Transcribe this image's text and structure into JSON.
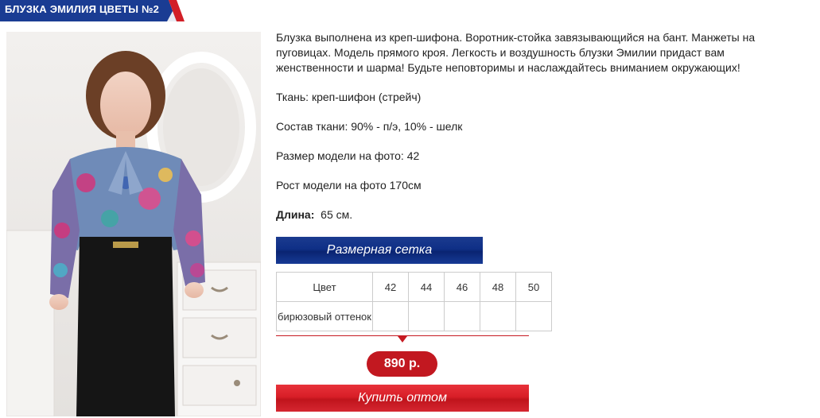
{
  "header": {
    "title": "БЛУЗКА ЭМИЛИЯ ЦВЕТЫ №2",
    "bg_color": "#1a3c93",
    "accent_color": "#d21f27"
  },
  "product": {
    "description": "Блузка выполнена из креп-шифона. Воротник-стойка завязывающийся на бант. Манжеты на пуговицах. Модель прямого кроя. Легкость и воздушность блузки Эмилии придаст вам женственности и шарма! Будьте неповторимы и наслаждайтесь вниманием окружающих!",
    "fabric": "Ткань: креп-шифон (стрейч)",
    "composition": "Состав ткани: 90% - п/э, 10% - шелк",
    "model_size": "Размер модели на фото: 42",
    "model_height": "Рост модели на фото 170см",
    "length_label": "Длина:",
    "length_value": "65 см."
  },
  "size_grid_button": "Размерная сетка",
  "size_table": {
    "header": [
      "Цвет",
      "42",
      "44",
      "46",
      "48",
      "50"
    ],
    "rows": [
      [
        "бирюзовый оттенок",
        "",
        "",
        "",
        "",
        ""
      ]
    ]
  },
  "price": "890 р.",
  "buy_button": "Купить оптом"
}
